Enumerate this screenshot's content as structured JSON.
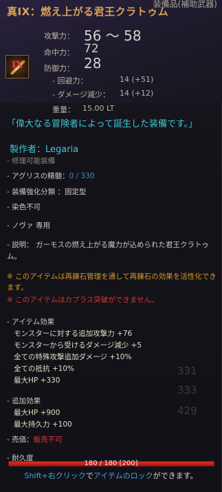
{
  "tooltip": {
    "category": "装備品(補助武器)",
    "title": "真IX：燃え上がる君王クラトゥム",
    "enhance_badge": "IX",
    "stats": {
      "attack_label": "攻撃力：",
      "attack_value": "56 ～ 58",
      "accuracy_label": "命中力：",
      "accuracy_value": "72",
      "defense_label": "防御力：",
      "defense_value": "28",
      "evasion_label": "- 回避力：",
      "evasion_value": "14 (+51)",
      "damage_reduction_label": "- ダメージ減少：",
      "damage_reduction_value": "14 (+12)",
      "weight_label": "重量：",
      "weight_value": "15.00 LT"
    },
    "quote": "「偉大なる冒険者によって誕生した装備です。」",
    "maker": "製作者：Legaria",
    "repairable": "- 修理可能装備",
    "cron": {
      "label": "- アグリスの精髄：",
      "value": "0 / 330"
    },
    "enhance_type": "- 装備強化分類 ：固定型",
    "dye": "- 染色不可",
    "nova": "- ノヴァ 専用",
    "description": "- 説明： ガーモスの燃え上がる魔力が込められた君王クラトゥム。",
    "note_yellow": "※ このアイテムは再錬石管理を通して再錬石の効果を活性化できます。",
    "note_red": "※ このアイテムはカプラス突破ができません。",
    "item_effects_title": "- アイテム効果",
    "item_effects": [
      "モンスターに対する追加攻撃力 +76",
      "モンスターから受けるダメージ減少 +5",
      "全ての特殊攻撃追加ダメージ +10%",
      "全ての抵抗 +10%",
      "最大HP +330"
    ],
    "extra_effects_title": "- 追加効果",
    "extra_effects": [
      "最大HP +900",
      "最大持久力 +100"
    ],
    "sell": {
      "label": "- 売価：",
      "value": "販売不可"
    },
    "durability": {
      "label": "- 耐久度",
      "text": "180 / 180 [200]",
      "fraction": 1.0
    },
    "hint": {
      "key": "Shift+右クリック",
      "mid": "で",
      "action": "アイテムのロック",
      "tail": "ができます。"
    }
  },
  "background_numbers": [
    "331",
    "333",
    "429"
  ],
  "colors": {
    "title": "#d9a25a",
    "cyan": "#3ec7d8",
    "warn_yellow": "#d49a2a",
    "warn_red": "#d23636",
    "dur_red": "#c8201a"
  }
}
